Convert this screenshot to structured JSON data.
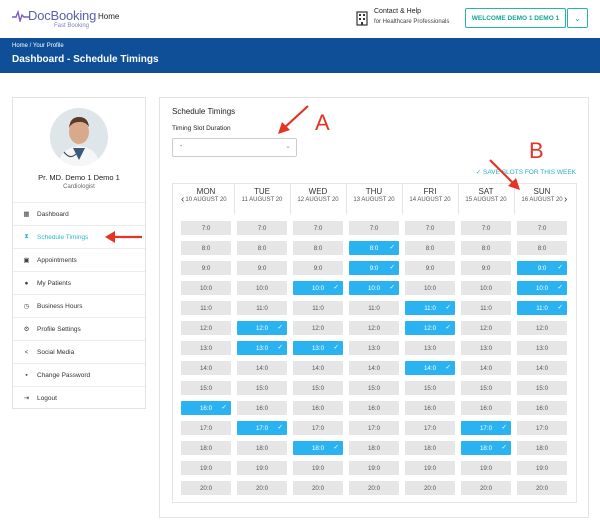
{
  "header": {
    "brand": "DocBooking",
    "tagline": "Fast Booking",
    "nav_home": "Home",
    "contact_title": "Contact & Help",
    "contact_sub": "for Healthcare Professionals",
    "welcome_label": "WELCOME DEMO 1 DEMO 1"
  },
  "banner": {
    "breadcrumb": "Home  /  Your Profile",
    "title": "Dashboard - Schedule Timings"
  },
  "profile": {
    "name": "Pr. MD. Demo 1 Demo 1",
    "role": "Cardiologist"
  },
  "menu": [
    {
      "label": "Dashboard",
      "icon": "grid-icon"
    },
    {
      "label": "Schedule Timings",
      "icon": "hourglass-icon",
      "active": true
    },
    {
      "label": "Appointments",
      "icon": "calendar-icon"
    },
    {
      "label": "My Patients",
      "icon": "user-icon"
    },
    {
      "label": "Business Hours",
      "icon": "clock-icon"
    },
    {
      "label": "Profile Settings",
      "icon": "user-cog-icon"
    },
    {
      "label": "Social Media",
      "icon": "share-icon"
    },
    {
      "label": "Change Password",
      "icon": "lock-icon"
    },
    {
      "label": "Logout",
      "icon": "logout-icon"
    }
  ],
  "schedule": {
    "title": "Schedule Timings",
    "duration_label": "Timing Slot Duration",
    "duration_value": "-",
    "save_label": "SAVE SLOTS FOR THIS WEEK",
    "days": [
      {
        "name": "MON",
        "date": "10 AUGUST 20"
      },
      {
        "name": "TUE",
        "date": "11 AUGUST 20"
      },
      {
        "name": "WED",
        "date": "12 AUGUST 20"
      },
      {
        "name": "THU",
        "date": "13 AUGUST 20"
      },
      {
        "name": "FRI",
        "date": "14 AUGUST 20"
      },
      {
        "name": "SAT",
        "date": "15 AUGUST 20"
      },
      {
        "name": "SUN",
        "date": "16 AUGUST 20"
      }
    ],
    "times": [
      "7:0",
      "8:0",
      "9:0",
      "10:0",
      "11:0",
      "12:0",
      "13:0",
      "14:0",
      "15:0",
      "16:0",
      "17:0",
      "18:0",
      "19:0",
      "20:0"
    ],
    "selected": {
      "MON": [
        "16:0"
      ],
      "TUE": [
        "12:0",
        "13:0",
        "17:0"
      ],
      "WED": [
        "10:0",
        "13:0",
        "18:0"
      ],
      "THU": [
        "8:0",
        "9:0",
        "10:0"
      ],
      "FRI": [
        "11:0",
        "12:0",
        "14:0"
      ],
      "SAT": [
        "17:0",
        "18:0"
      ],
      "SUN": [
        "9:0",
        "10:0",
        "11:0"
      ]
    }
  },
  "annotations": {
    "a": "A",
    "b": "B"
  },
  "colors": {
    "accent": "#2bb3f1",
    "banner": "#0e4f98",
    "teal": "#14a591",
    "arrow": "#e53423"
  }
}
